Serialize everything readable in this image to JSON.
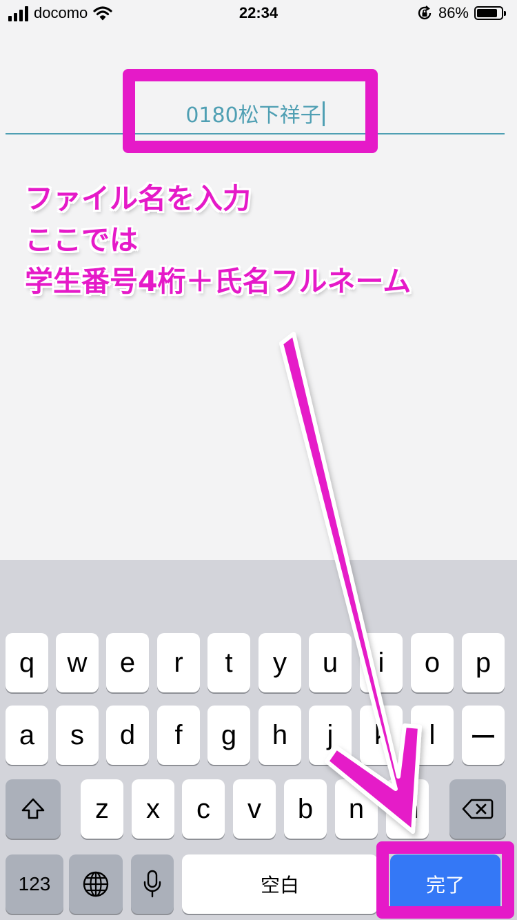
{
  "status_bar": {
    "carrier": "docomo",
    "time": "22:34",
    "battery_percent": "86%",
    "battery_level": 0.86,
    "icons": [
      "signal-icon",
      "wifi-icon",
      "rotation-lock-icon",
      "battery-icon"
    ]
  },
  "filename_field": {
    "value": "0180松下祥子"
  },
  "annotation": {
    "line1": "ファイル名を入力",
    "line2": "ここでは",
    "line3": "学生番号4桁＋氏名フルネーム",
    "color": "#e51ac8"
  },
  "keyboard": {
    "row1": [
      "q",
      "w",
      "e",
      "r",
      "t",
      "y",
      "u",
      "i",
      "o",
      "p"
    ],
    "row2": [
      "a",
      "s",
      "d",
      "f",
      "g",
      "h",
      "j",
      "k",
      "l",
      "ー"
    ],
    "row3": [
      "z",
      "x",
      "c",
      "v",
      "b",
      "n",
      "m"
    ],
    "numbers_label": "123",
    "space_label": "空白",
    "done_label": "完了",
    "icons": [
      "shift-icon",
      "delete-icon",
      "globe-icon",
      "microphone-icon"
    ],
    "done_color": "#3478f6"
  }
}
